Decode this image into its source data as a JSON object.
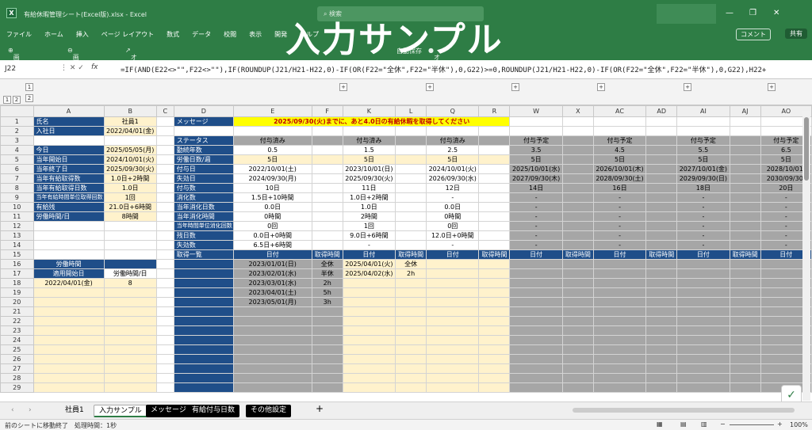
{
  "window": {
    "file_name": "有給休暇管理シート(Excel版).xlsx",
    "app": "Excel",
    "search": "検索"
  },
  "overlay_title": "入力サンプル",
  "menu": [
    "ファイル",
    "ホーム",
    "挿入",
    "ページ レイアウト",
    "数式",
    "データ",
    "校閲",
    "表示",
    "開発",
    "ヘルプ"
  ],
  "menu_right": {
    "comment": "コメント",
    "share": "共有"
  },
  "view_toolbar": {
    "zoom_in": "画面表示拡大",
    "zoom_out": "画面表示縮小",
    "select_object": "オブジェクトの選択",
    "autosave": "自動保存",
    "autosave_state": "オフ"
  },
  "formula_bar": {
    "name_box": "J22",
    "fx": "fx",
    "formula": "=IF(AND(E22<>\"\",F22<>\"\"),IF(ROUNDUP(J21/H21-H22,0)-IF(OR(F22=\"全休\",F22=\"半休\"),0,G22)>=0,ROUNDUP(J21/H21-H22,0)-IF(OR(F22=\"全休\",F22=\"半休\"),0,G22),H22+"
  },
  "group_levels": [
    "1",
    "2"
  ],
  "columns": [
    "A",
    "B",
    "C",
    "D",
    "E",
    "F",
    "K",
    "L",
    "Q",
    "R",
    "W",
    "X",
    "AC",
    "AD",
    "AI",
    "AJ",
    "AO"
  ],
  "rows": {
    "1": [
      "氏名",
      "社員1",
      "",
      "メッセージ",
      "2025/09/30(火)までに、あと4.0日の有給休暇を取得してください",
      "",
      "",
      "",
      "",
      "",
      "",
      "",
      "",
      "",
      "",
      "",
      ""
    ],
    "2": [
      "入社日",
      "2022/04/01(金)",
      "",
      "",
      "",
      "",
      "",
      "",
      "",
      "",
      "",
      "",
      "",
      "",
      "",
      "",
      ""
    ],
    "3": [
      "",
      "",
      "",
      "ステータス",
      "付与済み",
      "",
      "付与済み",
      "",
      "付与済み",
      "",
      "付与予定",
      "",
      "付与予定",
      "",
      "付与予定",
      "",
      "付与予定"
    ],
    "4": [
      "今日",
      "2025/05/05(月)",
      "",
      "勤続年数",
      "0.5",
      "",
      "1.5",
      "",
      "2.5",
      "",
      "3.5",
      "",
      "4.5",
      "",
      "5.5",
      "",
      "6.5"
    ],
    "5": [
      "当年開始日",
      "2024/10/01(火)",
      "",
      "労働日数/週",
      "5日",
      "",
      "5日",
      "",
      "5日",
      "",
      "5日",
      "",
      "5日",
      "",
      "5日",
      "",
      "5日"
    ],
    "6": [
      "当年終了日",
      "2025/09/30(火)",
      "",
      "付与日",
      "2022/10/01(土)",
      "",
      "2023/10/01(日)",
      "",
      "2024/10/01(火)",
      "",
      "2025/10/01(水)",
      "",
      "2026/10/01(木)",
      "",
      "2027/10/01(金)",
      "",
      "2028/10/01("
    ],
    "7": [
      "当年有給取得数",
      "1.0日+2時間",
      "",
      "失効日",
      "2024/09/30(月)",
      "",
      "2025/09/30(火)",
      "",
      "2026/09/30(水)",
      "",
      "2027/09/30(木)",
      "",
      "2028/09/30(土)",
      "",
      "2029/09/30(日)",
      "",
      "2030/09/30("
    ],
    "8": [
      "当年有給取得日数",
      "1.0日",
      "",
      "付与数",
      "10日",
      "",
      "11日",
      "",
      "12日",
      "",
      "14日",
      "",
      "16日",
      "",
      "18日",
      "",
      "20日"
    ],
    "9": [
      "当年有給時間単位取得回数",
      "1回",
      "",
      "消化数",
      "1.5日+10時間",
      "",
      "1.0日+2時間",
      "",
      "-",
      "",
      "-",
      "",
      "-",
      "",
      "-",
      "",
      "-"
    ],
    "10": [
      "有給残",
      "21.0日+6時間",
      "",
      "当年消化日数",
      "0.0日",
      "",
      "1.0日",
      "",
      "0.0日",
      "",
      "-",
      "",
      "-",
      "",
      "-",
      "",
      "-"
    ],
    "11": [
      "労働時間/日",
      "8時間",
      "",
      "当年消化時間",
      "0時間",
      "",
      "2時間",
      "",
      "0時間",
      "",
      "-",
      "",
      "-",
      "",
      "-",
      "",
      "-"
    ],
    "12": [
      "",
      "",
      "",
      "当年時間単位消化回数",
      "0回",
      "",
      "1回",
      "",
      "0回",
      "",
      "-",
      "",
      "-",
      "",
      "-",
      "",
      "-"
    ],
    "13": [
      "",
      "",
      "",
      "残日数",
      "0.0日+0時間",
      "",
      "9.0日+6時間",
      "",
      "12.0日+0時間",
      "",
      "-",
      "",
      "-",
      "",
      "-",
      "",
      "-"
    ],
    "14": [
      "",
      "",
      "",
      "失効数",
      "6.5日+6時間",
      "",
      "-",
      "",
      "-",
      "",
      "-",
      "",
      "-",
      "",
      "-",
      "",
      "-"
    ],
    "15": [
      "",
      "",
      "",
      "取得一覧",
      "日付",
      "取得時間",
      "日付",
      "取得時間",
      "日付",
      "取得時間",
      "日付",
      "取得時間",
      "日付",
      "取得時間",
      "日付",
      "取得時間",
      "日付"
    ],
    "16": [
      "労働時間",
      "",
      "",
      "",
      "2023/01/01(日)",
      "全休",
      "2025/04/01(火)",
      "全休",
      "",
      "",
      "",
      "",
      "",
      "",
      "",
      "",
      ""
    ],
    "17": [
      "適用開始日",
      "労働時間/日",
      "",
      "",
      "2023/02/01(水)",
      "半休",
      "2025/04/02(水)",
      "2h",
      "",
      "",
      "",
      "",
      "",
      "",
      "",
      "",
      ""
    ],
    "18": [
      "2022/04/01(金)",
      "8",
      "",
      "",
      "2023/03/01(水)",
      "2h",
      "",
      "",
      "",
      "",
      "",
      "",
      "",
      "",
      "",
      "",
      ""
    ],
    "19": [
      "",
      "",
      "",
      "",
      "2023/04/01(土)",
      "5h",
      "",
      "",
      "",
      "",
      "",
      "",
      "",
      "",
      "",
      "",
      ""
    ],
    "20": [
      "",
      "",
      "",
      "",
      "2023/05/01(月)",
      "3h",
      "",
      "",
      "",
      "",
      "",
      "",
      "",
      "",
      "",
      "",
      ""
    ]
  },
  "row_numbers": [
    "1",
    "2",
    "3",
    "4",
    "5",
    "6",
    "7",
    "8",
    "9",
    "10",
    "11",
    "12",
    "13",
    "14",
    "15",
    "16",
    "17",
    "18",
    "19",
    "20",
    "21",
    "22",
    "23",
    "24",
    "25",
    "26",
    "27",
    "28",
    "29"
  ],
  "sheet_tabs": [
    "社員1",
    "入力サンプル",
    "メッセージ",
    "有給付与日数",
    "その他設定"
  ],
  "status": {
    "left": "前のシートに移動終了　処理時間：1秒",
    "zoom": "100%"
  }
}
